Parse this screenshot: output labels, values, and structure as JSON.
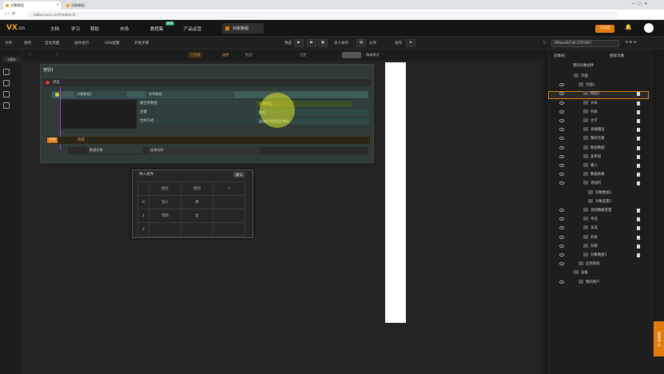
{
  "browser": {
    "tabs": [
      "对象数组",
      "功能数组"
    ],
    "url": "editor.vxcn.cn/#/editor/3"
  },
  "app": {
    "logo_main": "VX",
    "logo_sub": ".cn",
    "nav": [
      "文档",
      "学习",
      "帮助",
      "市场",
      "教程集",
      "产品运营"
    ],
    "new_badge": "新课",
    "active_tab": "对象数组",
    "workbench": "工作台"
  },
  "toolbar": {
    "left_items": [
      "文件",
      "保存",
      "自动页面",
      "插件提示",
      "SDK配置",
      "开发步骤"
    ],
    "mid_items": [
      "预览",
      "分享",
      "发布"
    ],
    "search_value": "iPhone6/7/8 375*667",
    "multi_screen": "多人协作"
  },
  "subbar": {
    "items": [
      "已生效",
      "组件",
      "数据",
      "设置"
    ],
    "right": "精确模式"
  },
  "left_rail": {
    "label": "小模块"
  },
  "logic": {
    "title": "按钮1",
    "row1_label": "点击",
    "row2_obj": "对象数组1",
    "row2_action": "合并数组",
    "param1_label": "被合并数组",
    "param1_value": "对象数组",
    "param2_label": "主键",
    "param2_value": "姓名",
    "param3_label": "合并方式",
    "param3_value": "追加新增数据为增加",
    "else_tag": "否则",
    "else_label": "完成",
    "row4_obj": "数据对象",
    "row4_action": "选择动作"
  },
  "popup": {
    "title": "导入组件",
    "button": "确认",
    "headers": [
      "姓名",
      "性别"
    ],
    "rows": [
      {
        "idx": "0",
        "name": "张三",
        "gender": "男"
      },
      {
        "idx": "1",
        "name": "李四",
        "gender": "女"
      },
      {
        "idx": "2",
        "name": "",
        "gender": ""
      }
    ]
  },
  "right_panel": {
    "tabs": [
      "对象树",
      "搜索对象"
    ],
    "root": "我的对象组件",
    "tree": [
      {
        "label": "页面",
        "indent": 1
      },
      {
        "label": "页面1",
        "indent": 2
      },
      {
        "label": "按钮1",
        "indent": 3
      },
      {
        "label": "文本",
        "indent": 3
      },
      {
        "label": "列表",
        "indent": 3
      },
      {
        "label": "文字",
        "indent": 3
      },
      {
        "label": "表格输出",
        "indent": 3
      },
      {
        "label": "我的元素",
        "indent": 3
      },
      {
        "label": "数组数据",
        "indent": 3
      },
      {
        "label": "表单组",
        "indent": 3
      },
      {
        "label": "输入",
        "indent": 3
      },
      {
        "label": "数据表格",
        "indent": 3
      },
      {
        "label": "添加列",
        "indent": 3
      },
      {
        "label": "对象数组2",
        "indent": 4
      },
      {
        "label": "对象变量1",
        "indent": 4
      },
      {
        "label": "添加数据变量",
        "indent": 3
      },
      {
        "label": "单选",
        "indent": 3
      },
      {
        "label": "多选",
        "indent": 3
      },
      {
        "label": "开关",
        "indent": 3
      },
      {
        "label": "日期",
        "indent": 3
      },
      {
        "label": "对象数组1",
        "indent": 3
      },
      {
        "label": "应用系统",
        "indent": 2
      },
      {
        "label": "设备",
        "indent": 1
      },
      {
        "label": "我的用户",
        "indent": 2
      }
    ],
    "float_button": "帮助中心"
  }
}
